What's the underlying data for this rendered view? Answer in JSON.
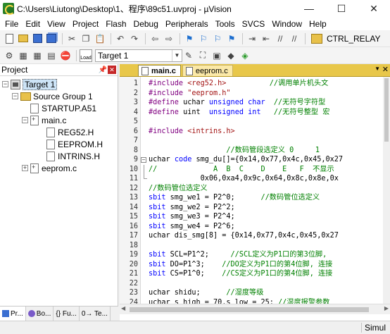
{
  "window": {
    "title": "C:\\Users\\Liutong\\Desktop\\1、程序\\89c51.uvproj - µVision",
    "controls": {
      "minimize": "—",
      "maximize": "☐",
      "close": "✕"
    }
  },
  "menu": [
    "File",
    "Edit",
    "View",
    "Project",
    "Flash",
    "Debug",
    "Peripherals",
    "Tools",
    "SVCS",
    "Window",
    "Help"
  ],
  "toolbar": {
    "ctrl_relay_label": "CTRL_RELAY",
    "target_select": "Target 1",
    "load_label": "Load"
  },
  "project_panel": {
    "title": "Project",
    "pin": "ᵖ",
    "close": "✕",
    "tree": {
      "target": "Target 1",
      "group": "Source Group 1",
      "startup": "STARTUP.A51",
      "main_c": "main.c",
      "includes": [
        "REG52.H",
        "EEPROM.H",
        "INTRINS.H"
      ],
      "eeprom_c": "eeprom.c"
    },
    "bottom_tabs": [
      "Pr...",
      "Bo...",
      "{} Fu...",
      "0→ Te..."
    ]
  },
  "editor": {
    "tabs": [
      {
        "label": "main.c",
        "active": true
      },
      {
        "label": "eeprom.c",
        "active": false
      }
    ],
    "line_numbers": [
      "1",
      "2",
      "3",
      "4",
      "5",
      "6",
      "7",
      "8",
      "9",
      "10",
      "11",
      "12",
      "13",
      "14",
      "15",
      "16",
      "17",
      "18",
      "19",
      "20",
      "21",
      "22",
      "23",
      "24"
    ],
    "lines": [
      [
        {
          "t": "#include ",
          "c": "pp"
        },
        {
          "t": "<reg52.h>",
          "c": "str"
        },
        {
          "t": "          //调用单片机头文",
          "c": "cm"
        }
      ],
      [
        {
          "t": "#include ",
          "c": "pp"
        },
        {
          "t": "\"eeprom.h\"",
          "c": "str"
        }
      ],
      [
        {
          "t": "#define ",
          "c": "pp"
        },
        {
          "t": "uchar ",
          "c": ""
        },
        {
          "t": "unsigned char",
          "c": "k"
        },
        {
          "t": "  //无符号字符型 ",
          "c": "cm"
        }
      ],
      [
        {
          "t": "#define ",
          "c": "pp"
        },
        {
          "t": "uint  ",
          "c": ""
        },
        {
          "t": "unsigned int",
          "c": "k"
        },
        {
          "t": "   //无符号整型 宏",
          "c": "cm"
        }
      ],
      [],
      [
        {
          "t": "#include ",
          "c": "pp"
        },
        {
          "t": "<intrins.h>",
          "c": "str"
        }
      ],
      [],
      [
        {
          "t": "                  //数码管段选定义 0     1",
          "c": "cm"
        }
      ],
      [
        {
          "t": "uchar ",
          "c": ""
        },
        {
          "t": "code ",
          "c": "k"
        },
        {
          "t": "smg_du[]={0x14,0x77,0x4c,0x45,0x27",
          "c": ""
        }
      ],
      [
        {
          "t": "//             A  B  C    D    E   F  不显示",
          "c": "cm"
        }
      ],
      [
        {
          "t": "            0x06,0xa4,0x9c,0x64,0x8c,0x8e,0x",
          "c": ""
        }
      ],
      [
        {
          "t": "//数码管位选定义",
          "c": "cm"
        }
      ],
      [
        {
          "t": "sbit ",
          "c": "k"
        },
        {
          "t": "smg_we1 = P2^0;      ",
          "c": ""
        },
        {
          "t": "//数码管位选定义",
          "c": "cm"
        }
      ],
      [
        {
          "t": "sbit ",
          "c": "k"
        },
        {
          "t": "smg_we2 = P2^2;",
          "c": ""
        }
      ],
      [
        {
          "t": "sbit ",
          "c": "k"
        },
        {
          "t": "smg_we3 = P2^4;",
          "c": ""
        }
      ],
      [
        {
          "t": "sbit ",
          "c": "k"
        },
        {
          "t": "smg_we4 = P2^6;",
          "c": ""
        }
      ],
      [
        {
          "t": "uchar dis_smg[8] = {0x14,0x77,0x4c,0x45,0x27",
          "c": ""
        }
      ],
      [],
      [
        {
          "t": "sbit ",
          "c": "k"
        },
        {
          "t": "SCL=P1^2;     ",
          "c": ""
        },
        {
          "t": "//SCL定义为P1口的第3位脚, ",
          "c": "cm"
        }
      ],
      [
        {
          "t": "sbit ",
          "c": "k"
        },
        {
          "t": "DO=P1^3;    ",
          "c": ""
        },
        {
          "t": "//DO定义为P1口的第4位脚, 连接",
          "c": "cm"
        }
      ],
      [
        {
          "t": "sbit ",
          "c": "k"
        },
        {
          "t": "CS=P1^0;    ",
          "c": ""
        },
        {
          "t": "//CS定义为P1口的第4位脚, 连接",
          "c": "cm"
        }
      ],
      [],
      [
        {
          "t": "uchar shidu;      ",
          "c": ""
        },
        {
          "t": "//湿度等级",
          "c": "cm"
        }
      ],
      [
        {
          "t": "uchar s_high = 70,s_low = 25; ",
          "c": ""
        },
        {
          "t": "//湿度报警参数",
          "c": "cm"
        }
      ]
    ]
  },
  "status": {
    "mode": "Simul"
  },
  "colors": {
    "tab_strip": "#e8c74a",
    "keyword": "#0000ff",
    "comment": "#008000",
    "preproc": "#800080",
    "string": "#a31515"
  }
}
